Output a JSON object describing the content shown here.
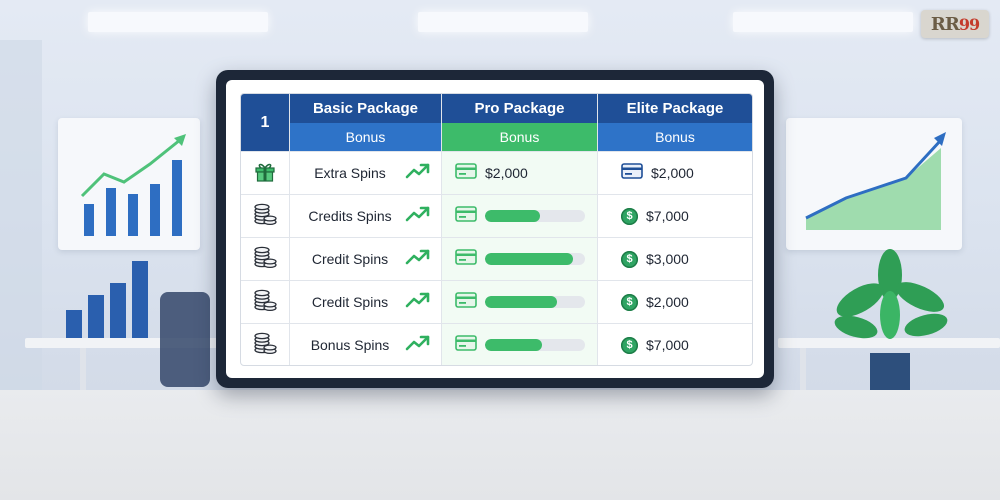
{
  "logo": {
    "text_rr": "RR",
    "text_99": "99"
  },
  "table": {
    "corner_label": "1",
    "columns": [
      {
        "title": "Basic Package",
        "sub": "Bonus"
      },
      {
        "title": "Pro Package",
        "sub": "Bonus"
      },
      {
        "title": "Elite Package",
        "sub": "Bonus"
      }
    ],
    "rows": [
      {
        "icon": "gift-icon",
        "label": "Extra Spins",
        "pro": {
          "type": "amount",
          "text": "$2,000"
        },
        "elite": {
          "icon": "credit-card-icon",
          "text": "$2,000"
        }
      },
      {
        "icon": "coins-icon",
        "label": "Credits Spins",
        "pro": {
          "type": "bar",
          "fill": 0.55
        },
        "elite": {
          "icon": "dollar-coin-icon",
          "text": "$7,000"
        }
      },
      {
        "icon": "coins-icon",
        "label": "Credit Spins",
        "pro": {
          "type": "bar",
          "fill": 0.88
        },
        "elite": {
          "icon": "dollar-coin-icon",
          "text": "$3,000"
        }
      },
      {
        "icon": "coins-icon",
        "label": "Credit Spins",
        "pro": {
          "type": "bar",
          "fill": 0.72
        },
        "elite": {
          "icon": "dollar-coin-icon",
          "text": "$2,000"
        }
      },
      {
        "icon": "coins-icon",
        "label": "Bonus Spins",
        "pro": {
          "type": "bar",
          "fill": 0.57
        },
        "elite": {
          "icon": "dollar-coin-icon",
          "text": "$7,000"
        }
      }
    ]
  },
  "colors": {
    "header_blue": "#1f4f97",
    "sub_blue": "#2e73c8",
    "accent_green": "#3dbb6a"
  }
}
